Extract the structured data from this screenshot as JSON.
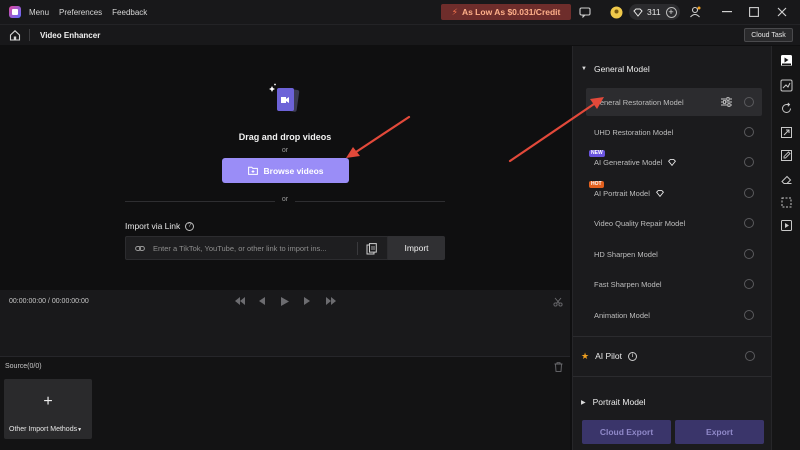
{
  "titlebar": {
    "menu": [
      "Menu",
      "Preferences",
      "Feedback"
    ],
    "promo": "As Low As $0.031/Credit",
    "credits": "311"
  },
  "toolbar": {
    "title": "Video Enhancer",
    "cloud_task": "Cloud Task"
  },
  "drop": {
    "title": "Drag and drop videos",
    "or1": "or",
    "browse_label": "Browse videos",
    "or2": "or",
    "import_via_link": "Import via Link",
    "link_placeholder": "Enter a TikTok, YouTube, or other link to import ins...",
    "import_button": "Import"
  },
  "player": {
    "timecode": "00:00:00:00 / 00:00:00:00"
  },
  "source": {
    "label": "Source(0/0)",
    "tile_label": "Other Import Methods"
  },
  "panel": {
    "general_model": "General Model",
    "models": [
      {
        "name": "General Restoration Model",
        "selected": true
      },
      {
        "name": "UHD Restoration Model"
      },
      {
        "name": "AI Generative Model",
        "badge": "NEW",
        "premium": true
      },
      {
        "name": "AI Portrait Model",
        "badge": "HOT",
        "premium": true
      },
      {
        "name": "Video Quality Repair Model"
      },
      {
        "name": "HD Sharpen Model"
      },
      {
        "name": "Fast Sharpen Model"
      },
      {
        "name": "Animation Model"
      }
    ],
    "ai_pilot": "AI Pilot",
    "portrait_model": "Portrait Model",
    "cloud_export": "Cloud Export",
    "export": "Export"
  },
  "colors": {
    "accent": "#9a8df7",
    "promo_bg": "#6e2d2b",
    "export_bg": "#3a356a",
    "annotation_arrow": "#e2493a"
  }
}
